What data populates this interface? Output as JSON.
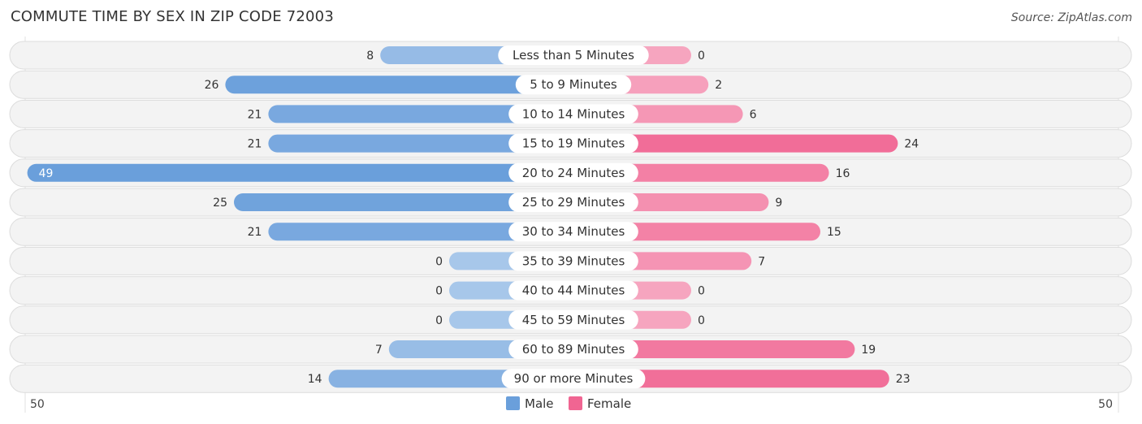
{
  "chart_data": {
    "type": "bar",
    "orientation": "horizontal-diverging",
    "title": "COMMUTE TIME BY SEX IN ZIP CODE 72003",
    "source": "Source: ZipAtlas.com",
    "categories": [
      "Less than 5 Minutes",
      "5 to 9 Minutes",
      "10 to 14 Minutes",
      "15 to 19 Minutes",
      "20 to 24 Minutes",
      "25 to 29 Minutes",
      "30 to 34 Minutes",
      "35 to 39 Minutes",
      "40 to 44 Minutes",
      "45 to 59 Minutes",
      "60 to 89 Minutes",
      "90 or more Minutes"
    ],
    "series": [
      {
        "name": "Male",
        "color": "#6a9fdb",
        "side": "left",
        "values": [
          8,
          26,
          21,
          21,
          49,
          25,
          21,
          0,
          0,
          0,
          7,
          14
        ]
      },
      {
        "name": "Female",
        "color": "#f06592",
        "side": "right",
        "values": [
          0,
          2,
          6,
          24,
          16,
          9,
          15,
          7,
          0,
          0,
          19,
          23
        ]
      }
    ],
    "axis": {
      "left_label": "50",
      "right_label": "50",
      "max": 50
    },
    "legend": {
      "position": "bottom-center",
      "items": [
        "Male",
        "Female"
      ]
    }
  }
}
